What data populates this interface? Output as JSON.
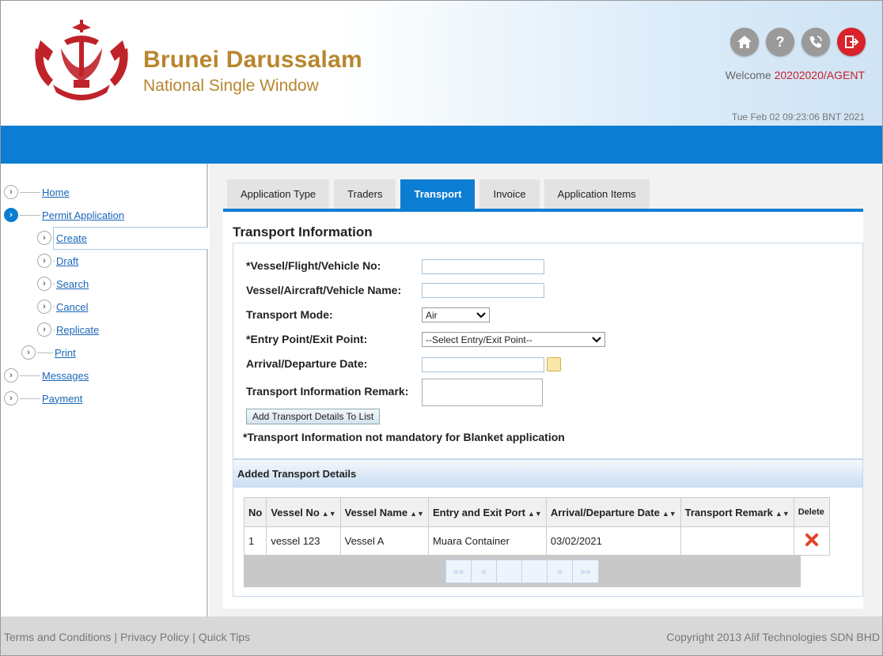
{
  "header": {
    "brand_line1": "Brunei Darussalam",
    "brand_line2": "National Single Window",
    "welcome_prefix": "Welcome ",
    "user": "20202020/AGENT",
    "datetime": "Tue Feb 02 09:23:06 BNT 2021",
    "icons": [
      "home-icon",
      "help-icon",
      "phone-icon",
      "logout-icon"
    ]
  },
  "sidebar": {
    "home": "Home",
    "permit_application": "Permit Application",
    "create": "Create",
    "draft": "Draft",
    "search": "Search",
    "cancel": "Cancel",
    "replicate": "Replicate",
    "print": "Print",
    "messages": "Messages",
    "payment": "Payment"
  },
  "tabs": [
    "Application Type",
    "Traders",
    "Transport",
    "Invoice",
    "Application Items"
  ],
  "active_tab": "Transport",
  "form": {
    "title": "Transport Information",
    "vessel_no_label": "*Vessel/Flight/Vehicle No:",
    "vessel_no_value": "",
    "vessel_name_label": "Vessel/Aircraft/Vehicle Name:",
    "vessel_name_value": "",
    "transport_mode_label": "Transport Mode:",
    "transport_mode_value": "Air",
    "entry_point_label": "*Entry Point/Exit Point:",
    "entry_point_value": "--Select Entry/Exit Point--",
    "arrival_date_label": "Arrival/Departure Date:",
    "arrival_date_value": "",
    "remark_label": "Transport Information Remark:",
    "add_button": "Add Transport Details To List",
    "note": "*Transport Information not mandatory for Blanket application"
  },
  "added": {
    "title": "Added Transport Details",
    "columns": [
      "No",
      "Vessel No",
      "Vessel Name",
      "Entry and Exit Port",
      "Arrival/Departure Date",
      "Transport Remark",
      "Delete"
    ],
    "rows": [
      {
        "no": "1",
        "vessel_no": "vessel 123",
        "vessel_name": "Vessel A",
        "port": "Muara Container",
        "date": "03/02/2021",
        "remark": ""
      }
    ],
    "pager": [
      "««",
      "«",
      "",
      "",
      "»",
      "»»"
    ]
  },
  "footer": {
    "terms": "Terms and Conditions",
    "privacy": "Privacy Policy",
    "tips": "Quick Tips",
    "separator": "|",
    "copyright": "Copyright 2013 Alif Technologies SDN BHD"
  },
  "colors": {
    "accent": "#0b7dd2",
    "brand_gold": "#b8862e",
    "logout_red": "#d9222a"
  }
}
